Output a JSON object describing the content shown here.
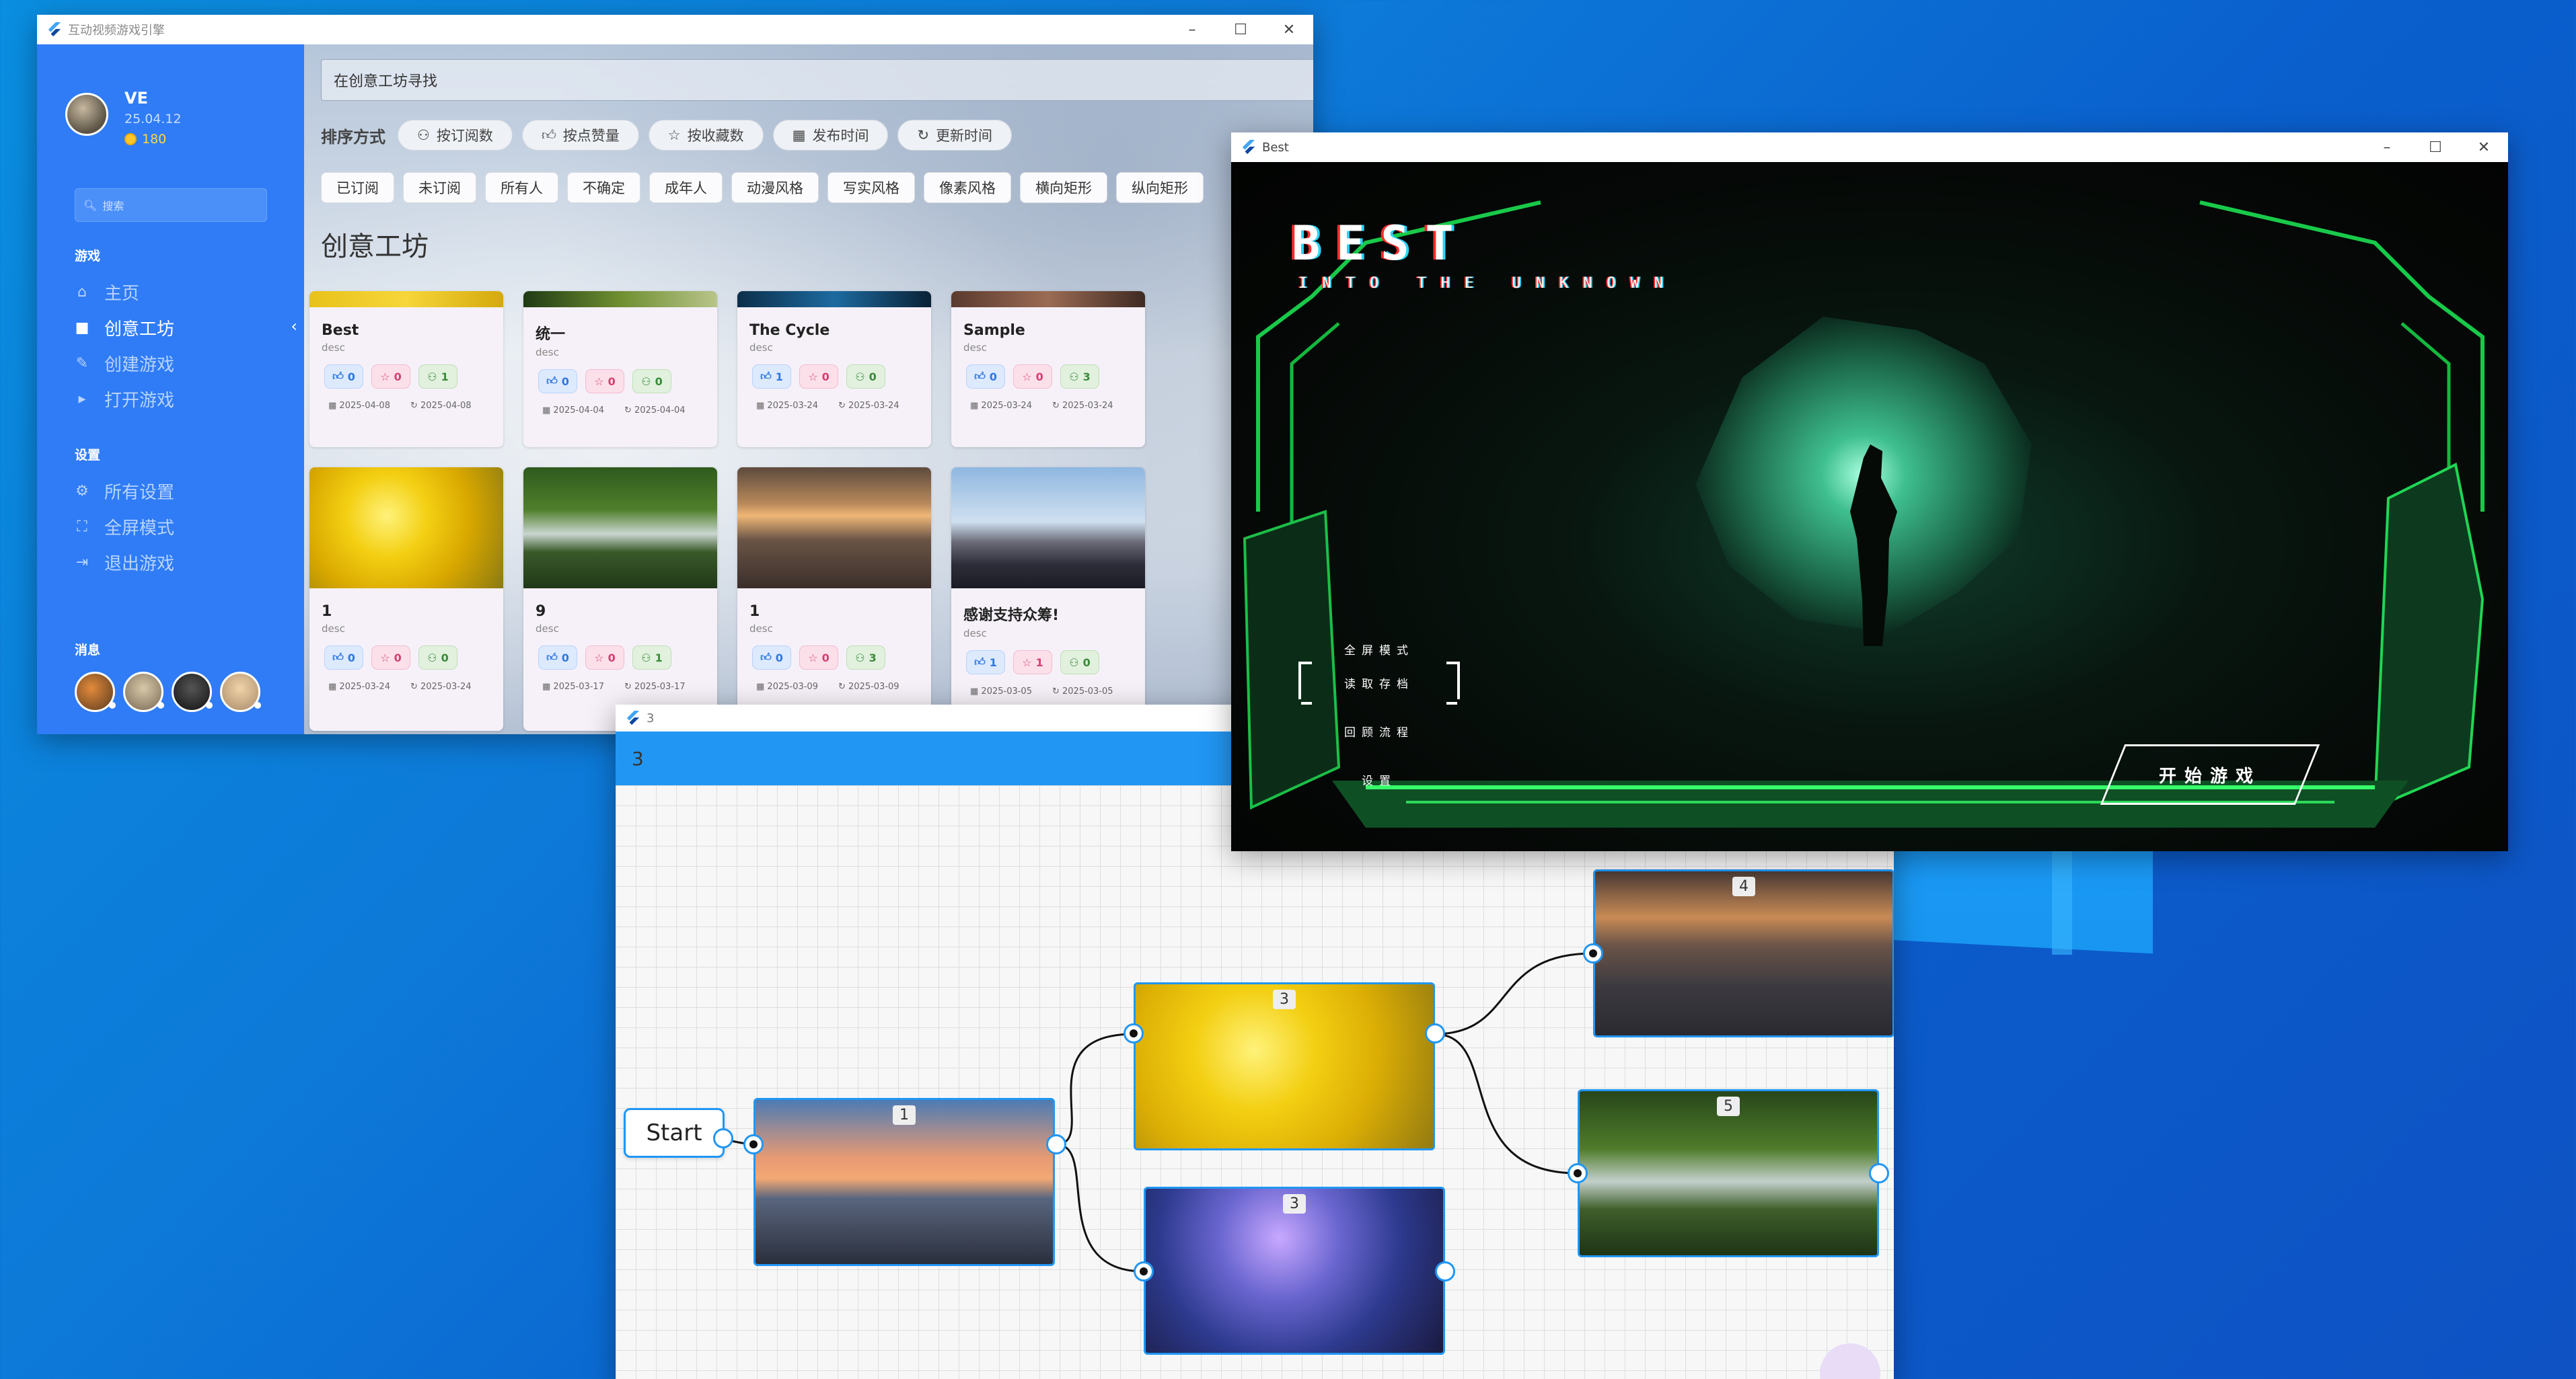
{
  "workshop": {
    "title": "互动视频游戏引擎",
    "user": {
      "name": "VE",
      "version": "25.04.12",
      "coins": "180"
    },
    "side_search_placeholder": "搜索",
    "sections": {
      "games": "游戏",
      "settings": "设置",
      "messages": "消息"
    },
    "nav_games": [
      {
        "label": "主页",
        "icon": "home-icon"
      },
      {
        "label": "创意工坊",
        "icon": "briefcase-icon"
      },
      {
        "label": "创建游戏",
        "icon": "pencil-icon"
      },
      {
        "label": "打开游戏",
        "icon": "play-icon"
      }
    ],
    "nav_settings": [
      {
        "label": "所有设置",
        "icon": "gear-icon"
      },
      {
        "label": "全屏模式",
        "icon": "fullscreen-icon"
      },
      {
        "label": "退出游戏",
        "icon": "exit-icon"
      }
    ],
    "search_placeholder": "在创意工坊寻找",
    "sort_label": "排序方式",
    "sort_options": [
      "按订阅数",
      "按点赞量",
      "按收藏数",
      "发布时间",
      "更新时间"
    ],
    "tags": [
      "已订阅",
      "未订阅",
      "所有人",
      "不确定",
      "成年人",
      "动漫风格",
      "写实风格",
      "像素风格",
      "横向矩形",
      "纵向矩形"
    ],
    "page_title": "创意工坊",
    "cards": [
      {
        "title": "Best",
        "desc": "desc",
        "likes": "0",
        "favs": "0",
        "subs": "1",
        "created": "2025-04-08",
        "updated": "2025-04-08"
      },
      {
        "title": "统一",
        "desc": "desc",
        "likes": "0",
        "favs": "0",
        "subs": "0",
        "created": "2025-04-04",
        "updated": "2025-04-04"
      },
      {
        "title": "The Cycle",
        "desc": "desc",
        "likes": "1",
        "favs": "0",
        "subs": "0",
        "created": "2025-03-24",
        "updated": "2025-03-24"
      },
      {
        "title": "Sample",
        "desc": "desc",
        "likes": "0",
        "favs": "0",
        "subs": "3",
        "created": "2025-03-24",
        "updated": "2025-03-24"
      },
      {
        "title": "1",
        "desc": "desc",
        "likes": "0",
        "favs": "0",
        "subs": "0",
        "created": "2025-03-24",
        "updated": "2025-03-24"
      },
      {
        "title": "9",
        "desc": "desc",
        "likes": "0",
        "favs": "0",
        "subs": "1",
        "created": "2025-03-17",
        "updated": "2025-03-17"
      },
      {
        "title": "1",
        "desc": "desc",
        "likes": "0",
        "favs": "0",
        "subs": "3",
        "created": "2025-03-09",
        "updated": "2025-03-09"
      },
      {
        "title": "感谢支持众筹!",
        "desc": "desc",
        "likes": "1",
        "favs": "1",
        "subs": "0",
        "created": "2025-03-05",
        "updated": "2025-03-05"
      }
    ]
  },
  "game": {
    "window_title": "Best",
    "title": "BEST",
    "subtitle": "INTO THE UNKNOWN",
    "menu": [
      "全屏模式",
      "读取存档",
      "回顾流程",
      "设置"
    ],
    "start_label": "开始游戏"
  },
  "flow": {
    "window_title": "3",
    "header": "3",
    "start_label": "Start",
    "nodes": [
      "1",
      "3",
      "3",
      "4",
      "5"
    ]
  }
}
